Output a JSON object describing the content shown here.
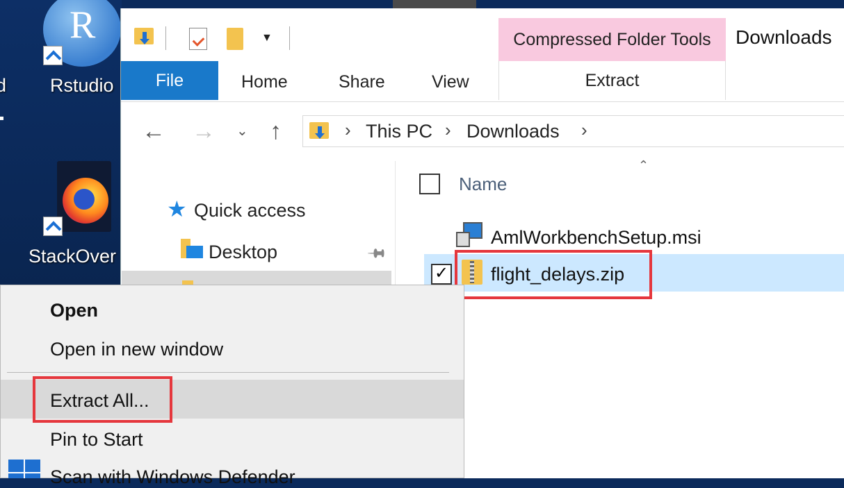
{
  "desktop": {
    "icons": [
      {
        "label": "Rstudio"
      },
      {
        "label": "StackOver"
      }
    ],
    "edge_text": "d"
  },
  "ribbon": {
    "tabs": {
      "file": "File",
      "home": "Home",
      "share": "Share",
      "view": "View"
    },
    "contextual_group": "Compressed Folder Tools",
    "contextual_tab": "Extract",
    "window_title": "Downloads"
  },
  "address_bar": {
    "breadcrumbs": [
      "This PC",
      "Downloads"
    ]
  },
  "nav_pane": {
    "items": [
      {
        "label": "Quick access"
      },
      {
        "label": "Desktop"
      }
    ]
  },
  "file_list": {
    "column_header": "Name",
    "files": [
      {
        "name": "AmlWorkbenchSetup.msi",
        "selected": false
      },
      {
        "name": "flight_delays.zip",
        "selected": true
      }
    ]
  },
  "context_menu": {
    "items": [
      {
        "label": "Open",
        "bold": true
      },
      {
        "label": "Open in new window"
      },
      {
        "label": "Extract All..."
      },
      {
        "label": "Pin to Start"
      },
      {
        "label": "Scan with Windows Defender"
      }
    ]
  },
  "colors": {
    "file_tab": "#1979ca",
    "contextual_tab": "#f9c9df",
    "selection": "#cce8ff",
    "highlight_box": "#e5373d",
    "desktop_bg": "#0b2a5b"
  }
}
